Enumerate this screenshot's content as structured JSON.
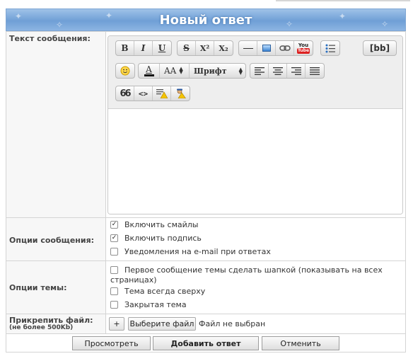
{
  "form": {
    "title": "Новый ответ"
  },
  "message": {
    "label": "Текст сообщения:",
    "body": ""
  },
  "toolbar": {
    "bold": "B",
    "italic": "I",
    "underline": "U",
    "strike": "S",
    "sup": "X²",
    "sub": "X₂",
    "bb": "[bb]",
    "youtube_top": "You",
    "youtube_bottom": "Tube",
    "font_size": "AA",
    "font_select": "Шрифт",
    "quote": "66",
    "code": "<>"
  },
  "options": {
    "label": "Опции сообщения:",
    "items": [
      {
        "label": "Включить смайлы",
        "checked": true
      },
      {
        "label": "Включить подпись",
        "checked": true
      },
      {
        "label": "Уведомления на e-mail при ответах",
        "checked": false
      }
    ]
  },
  "topic": {
    "label": "Опции темы:",
    "items": [
      {
        "label": "Первое сообщение темы сделать шапкой (показывать на всех",
        "label_cont": "страницах)",
        "checked": false
      },
      {
        "label": "Тема всегда сверху",
        "checked": false
      },
      {
        "label": "Закрытая тема",
        "checked": false
      }
    ]
  },
  "attach": {
    "label": "Прикрепить файл:",
    "sublabel": "(не более 500Kb)",
    "add": "+",
    "choose": "Выберите файл",
    "status": "Файл не выбран"
  },
  "actions": {
    "preview": "Просмотреть",
    "submit": "Добавить ответ",
    "cancel": "Отменить"
  }
}
